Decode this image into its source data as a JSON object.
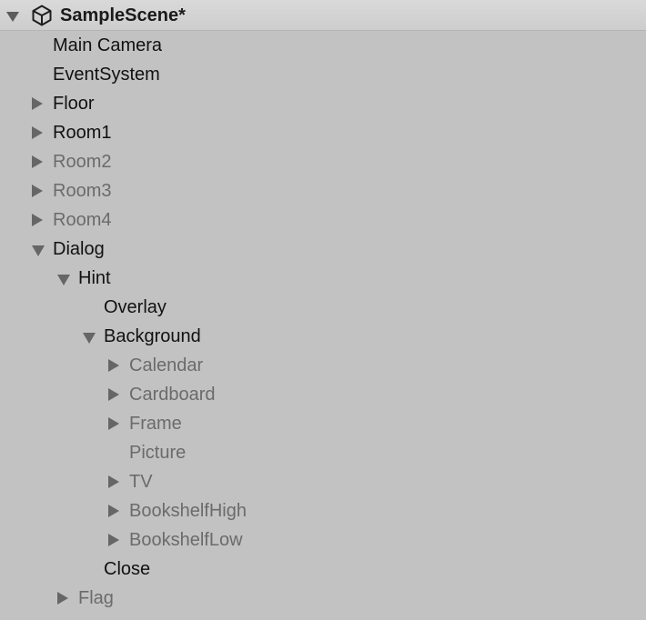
{
  "scene": {
    "name": "SampleScene*",
    "icon": "unity-logo-icon",
    "expanded": true
  },
  "items": [
    {
      "label": "Main Camera",
      "depth": 0,
      "toggle": "none",
      "active": true
    },
    {
      "label": "EventSystem",
      "depth": 0,
      "toggle": "none",
      "active": true
    },
    {
      "label": "Floor",
      "depth": 0,
      "toggle": "collapsed",
      "active": true
    },
    {
      "label": "Room1",
      "depth": 0,
      "toggle": "collapsed",
      "active": true
    },
    {
      "label": "Room2",
      "depth": 0,
      "toggle": "collapsed",
      "active": false
    },
    {
      "label": "Room3",
      "depth": 0,
      "toggle": "collapsed",
      "active": false
    },
    {
      "label": "Room4",
      "depth": 0,
      "toggle": "collapsed",
      "active": false
    },
    {
      "label": "Dialog",
      "depth": 0,
      "toggle": "expanded",
      "active": true
    },
    {
      "label": "Hint",
      "depth": 1,
      "toggle": "expanded",
      "active": true
    },
    {
      "label": "Overlay",
      "depth": 2,
      "toggle": "none",
      "active": true
    },
    {
      "label": "Background",
      "depth": 2,
      "toggle": "expanded",
      "active": true
    },
    {
      "label": "Calendar",
      "depth": 3,
      "toggle": "collapsed",
      "active": false
    },
    {
      "label": "Cardboard",
      "depth": 3,
      "toggle": "collapsed",
      "active": false
    },
    {
      "label": "Frame",
      "depth": 3,
      "toggle": "collapsed",
      "active": false
    },
    {
      "label": "Picture",
      "depth": 3,
      "toggle": "none",
      "active": false
    },
    {
      "label": "TV",
      "depth": 3,
      "toggle": "collapsed",
      "active": false
    },
    {
      "label": "BookshelfHigh",
      "depth": 3,
      "toggle": "collapsed",
      "active": false
    },
    {
      "label": "BookshelfLow",
      "depth": 3,
      "toggle": "collapsed",
      "active": false
    },
    {
      "label": "Close",
      "depth": 2,
      "toggle": "none",
      "active": true
    },
    {
      "label": "Flag",
      "depth": 1,
      "toggle": "collapsed",
      "active": false
    }
  ]
}
